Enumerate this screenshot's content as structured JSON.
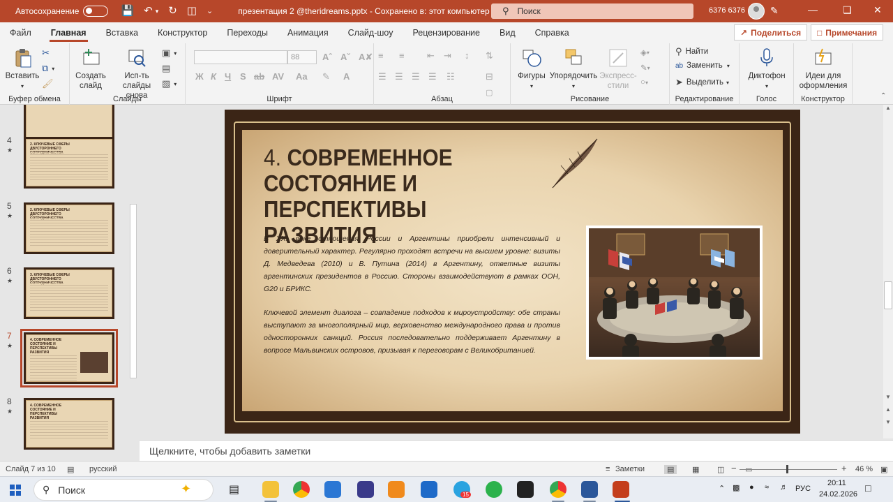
{
  "titlebar": {
    "autosave": "Автосохранение",
    "document": "презентация 2 @theridreams.pptx  -  Сохранено в: этот компьютер",
    "search_placeholder": "Поиск",
    "user": "6376 6376"
  },
  "tabs": [
    "Файл",
    "Главная",
    "Вставка",
    "Конструктор",
    "Переходы",
    "Анимация",
    "Слайд-шоу",
    "Рецензирование",
    "Вид",
    "Справка"
  ],
  "share_label": "Поделиться",
  "comments_label": "Примечания",
  "ribbon": {
    "groups": {
      "clipboard": "Буфер обмена",
      "slides": "Слайды",
      "font": "Шрифт",
      "paragraph": "Абзац",
      "drawing": "Рисование",
      "editing": "Редактирование",
      "voice": "Голос",
      "designer": "Конструктор"
    },
    "paste": "Вставить",
    "new_slide": "Создать слайд",
    "reuse_slides": "Исп-ть слайды снова",
    "font_size": "88",
    "shapes": "Фигуры",
    "arrange": "Упорядочить",
    "quick_styles": "Экспресс-стили",
    "find": "Найти",
    "replace": "Заменить",
    "select": "Выделить",
    "dictate": "Диктофон",
    "design_ideas": "Идеи для оформления",
    "format_letters": [
      "Ж",
      "К",
      "Ч",
      "S",
      "ab",
      "AV",
      "Aa"
    ]
  },
  "thumbnails": [
    {
      "num": "4",
      "title": "2. КЛЮЧЕВЫЕ СФЕРЫ ДВУСТОРОННЕГО СОТРУДНИЧЕСТВА"
    },
    {
      "num": "5",
      "title": "2. КЛЮЧЕВЫЕ СФЕРЫ ДВУСТОРОННЕГО СОТРУДНИЧЕСТВА"
    },
    {
      "num": "6",
      "title": "3. КЛЮЧЕВЫЕ СФЕРЫ ДВУСТОРОННЕГО СОТРУДНИЧЕСТВА"
    },
    {
      "num": "7",
      "title": "4. СОВРЕМЕННОЕ СОСТОЯНИЕ И ПЕРСПЕКТИВЫ РАЗВИТИЯ"
    },
    {
      "num": "8",
      "title": "4. СОВРЕМЕННОЕ СОСТОЯНИЕ И ПЕРСПЕКТИВЫ РАЗВИТИЯ"
    }
  ],
  "slide": {
    "title_num": "4.",
    "title_text": "СОВРЕМЕННОЕ СОСТОЯНИЕ И ПЕРСПЕКТИВЫ РАЗВИТИЯ",
    "paragraph1": "В XXI веке отношения России и Аргентины приобрели интенсивный и доверительный характер. Регулярно проходят встречи на высшем уровне: визиты Д. Медведева (2010) и В. Путина (2014) в Аргентину, ответные визиты аргентинских президентов в Россию. Стороны взаимодействуют в рамках ООН, G20 и БРИКС.",
    "paragraph2": "Ключевой элемент диалога – совпадение подходов к мироустройству: обе страны выступают за многополярный мир, верховенство международного права и против односторонних санкций. Россия последовательно поддерживает Аргентину в вопросе Мальвинских островов, призывая к переговорам с Великобританией."
  },
  "notes_placeholder": "Щелкните, чтобы добавить заметки",
  "status": {
    "slide_counter": "Слайд 7 из 10",
    "language": "русский",
    "notes_btn": "Заметки",
    "zoom": "46 %"
  },
  "taskbar": {
    "search": "Поиск",
    "lang": "РУС",
    "time": "20:11",
    "date": "24.02.2026",
    "telegram_badge": "15"
  },
  "colors": {
    "accent": "#b7472a",
    "slide_border": "#3b2516",
    "slide_paper": "#ecd9b6"
  }
}
